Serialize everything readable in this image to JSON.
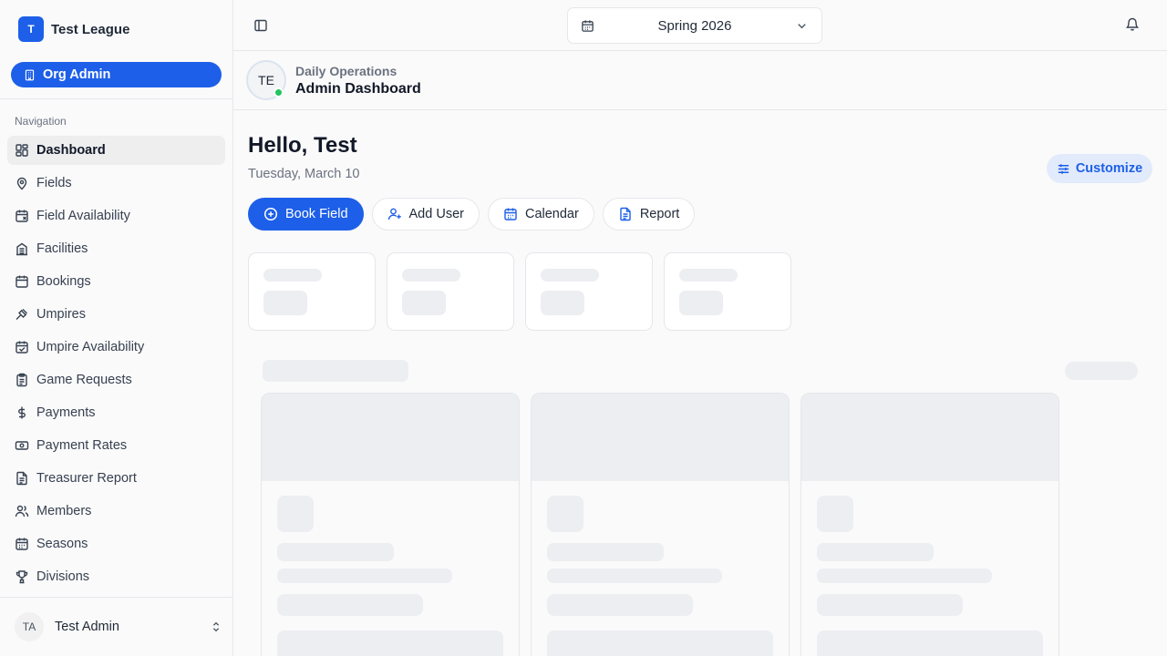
{
  "sidebar": {
    "league_initial": "T",
    "league_name": "Test League",
    "org_button": "Org Admin",
    "nav_title": "Navigation",
    "items": [
      {
        "label": "Dashboard",
        "icon": "dashboard-icon",
        "active": true
      },
      {
        "label": "Fields",
        "icon": "map-pin-icon"
      },
      {
        "label": "Field Availability",
        "icon": "calendar-x-icon"
      },
      {
        "label": "Facilities",
        "icon": "building-icon"
      },
      {
        "label": "Bookings",
        "icon": "calendar-icon"
      },
      {
        "label": "Umpires",
        "icon": "gavel-icon"
      },
      {
        "label": "Umpire Availability",
        "icon": "calendar-check-icon"
      },
      {
        "label": "Game Requests",
        "icon": "clipboard-icon"
      },
      {
        "label": "Payments",
        "icon": "dollar-icon"
      },
      {
        "label": "Payment Rates",
        "icon": "banknote-icon"
      },
      {
        "label": "Treasurer Report",
        "icon": "file-text-icon"
      },
      {
        "label": "Members",
        "icon": "users-icon"
      },
      {
        "label": "Seasons",
        "icon": "calendar-icon"
      },
      {
        "label": "Divisions",
        "icon": "trophy-icon"
      }
    ],
    "user": {
      "initials": "TA",
      "name": "Test Admin"
    }
  },
  "topbar": {
    "season": "Spring 2026"
  },
  "page_header": {
    "avatar_initials": "TE",
    "subtitle": "Daily Operations",
    "title": "Admin Dashboard"
  },
  "main": {
    "greeting": "Hello, Test",
    "date": "Tuesday, March 10",
    "customize_label": "Customize",
    "actions": [
      {
        "label": "Book Field",
        "icon": "plus-circle-icon",
        "primary": true
      },
      {
        "label": "Add User",
        "icon": "user-plus-icon"
      },
      {
        "label": "Calendar",
        "icon": "calendar-icon"
      },
      {
        "label": "Report",
        "icon": "file-text-icon"
      }
    ]
  },
  "colors": {
    "accent": "#1d5fe8",
    "accent_light": "#e2ebfb",
    "online": "#22c55e",
    "skeleton": "#eceef1"
  }
}
